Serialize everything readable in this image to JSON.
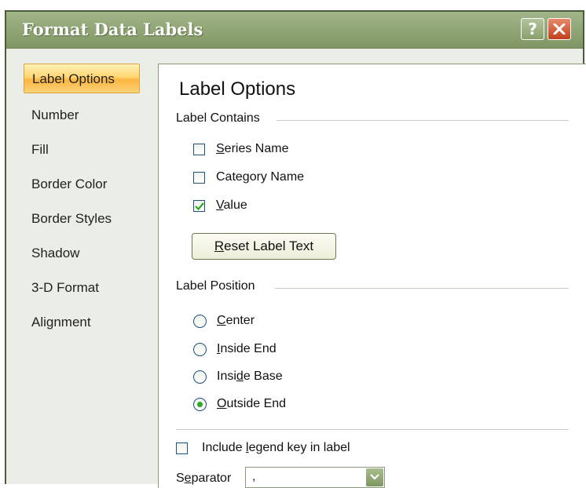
{
  "dialog": {
    "title": "Format Data Labels",
    "help_label": "?"
  },
  "sidebar": {
    "items": [
      {
        "label": "Label Options",
        "active": true
      },
      {
        "label": "Number"
      },
      {
        "label": "Fill"
      },
      {
        "label": "Border Color"
      },
      {
        "label": "Border Styles"
      },
      {
        "label": "Shadow"
      },
      {
        "label": "3-D Format"
      },
      {
        "label": "Alignment"
      }
    ]
  },
  "panel": {
    "title": "Label Options",
    "label_contains": {
      "heading": "Label Contains",
      "options": [
        {
          "pre": "",
          "mnemonic": "S",
          "post": "eries Name",
          "checked": false
        },
        {
          "pre": "Cate",
          "mnemonic": "g",
          "post": "ory Name",
          "checked": false
        },
        {
          "pre": "",
          "mnemonic": "V",
          "post": "alue",
          "checked": true
        }
      ],
      "reset_button": {
        "pre": "",
        "mnemonic": "R",
        "post": "eset Label Text"
      }
    },
    "label_position": {
      "heading": "Label Position",
      "options": [
        {
          "pre": "",
          "mnemonic": "C",
          "post": "enter",
          "selected": false
        },
        {
          "pre": "",
          "mnemonic": "I",
          "post": "nside End",
          "selected": false
        },
        {
          "pre": "Insi",
          "mnemonic": "d",
          "post": "e Base",
          "selected": false
        },
        {
          "pre": "",
          "mnemonic": "O",
          "post": "utside End",
          "selected": true
        }
      ]
    },
    "legend_key": {
      "pre": "Include ",
      "mnemonic": "l",
      "post": "egend key in label",
      "checked": false
    },
    "separator": {
      "pre": "S",
      "mnemonic": "e",
      "post": "parator",
      "value": ","
    }
  },
  "colors": {
    "titlebar": "#92a878",
    "active_tab": "#fbb640",
    "check_mark": "#2ea81e",
    "close_button": "#c0401e"
  }
}
